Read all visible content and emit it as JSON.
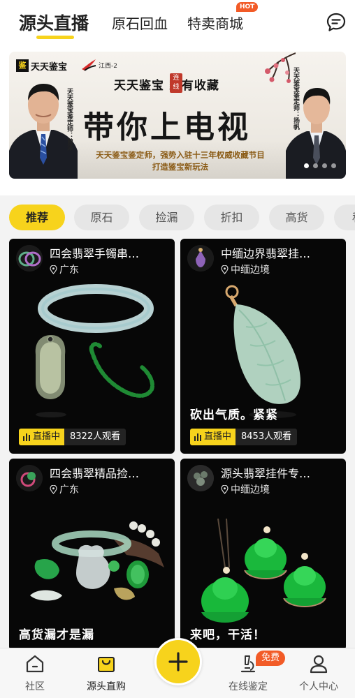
{
  "top_nav": {
    "tabs": [
      {
        "label": "源头直播"
      },
      {
        "label": "原石回血"
      },
      {
        "label": "特卖商城"
      }
    ],
    "hot_badge": "HOT",
    "message_icon": "chat-bubble-icon"
  },
  "banner": {
    "logo_text": "天天鉴宝",
    "logo_mark": "鉴",
    "partner_text": "江西-2",
    "title": "天天鉴宝 家有收藏",
    "link_seal": "连线",
    "headline": "带你上电视",
    "subtitle_line1": "天天鉴宝鉴定师，强势入驻十三年权威收藏节目",
    "subtitle_line2": "打造鉴宝新玩法",
    "left_host_label": "天天鉴宝鉴定师：曾泽",
    "right_host_label": "天天鉴宝鉴定师：扬帆",
    "slide_count": 4,
    "active_slide": 1
  },
  "categories": [
    {
      "label": "推荐",
      "active": true
    },
    {
      "label": "原石"
    },
    {
      "label": "捡漏"
    },
    {
      "label": "折扣"
    },
    {
      "label": "高货"
    },
    {
      "label": "私"
    }
  ],
  "streams": [
    {
      "title": "四会翡翠手镯串…",
      "location": "广东",
      "caption": "",
      "status": "直播中",
      "viewers": "8322人观看"
    },
    {
      "title": "中缅边界翡翠挂…",
      "location": "中缅边境",
      "caption": "砍出气质。紧紧",
      "status": "直播中",
      "viewers": "8453人观看"
    },
    {
      "title": "四会翡翠精品捡…",
      "location": "广东",
      "caption": "高货漏才是漏"
    },
    {
      "title": "源头翡翠挂件专…",
      "location": "中缅边境",
      "caption": "来吧，干活！"
    }
  ],
  "bottom_nav": {
    "items": [
      {
        "label": "社区",
        "icon": "home-icon"
      },
      {
        "label": "源头直购",
        "icon": "shopping-bag-icon",
        "active": true
      },
      {
        "label": "",
        "icon": "plus-icon"
      },
      {
        "label": "在线鉴定",
        "icon": "microscope-icon"
      },
      {
        "label": "个人中心",
        "icon": "person-icon"
      }
    ],
    "free_badge": "免费"
  },
  "colors": {
    "accent_yellow": "#f7d31c",
    "badge_orange": "#f25b27",
    "card_bg": "#070707",
    "page_bg": "#f3f3f3"
  }
}
